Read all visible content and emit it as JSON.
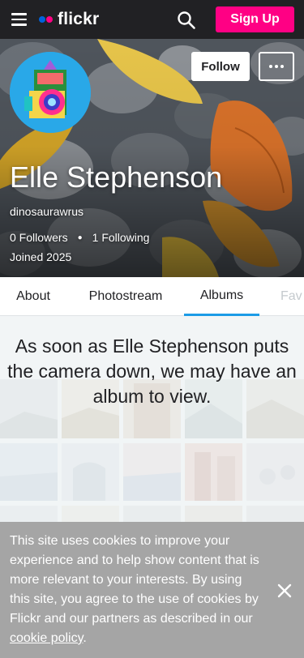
{
  "header": {
    "logo_text": "flickr",
    "signup_label": "Sign Up",
    "icons": [
      "menu-icon",
      "search-icon"
    ],
    "colors": {
      "bar": "#212124",
      "brand_blue": "#0063dc",
      "brand_pink": "#ff0084"
    }
  },
  "profile": {
    "follow_label": "Follow",
    "name": "Elle Stephenson",
    "username": "dinosaurawrus",
    "followers": "0 Followers",
    "following": "1 Following",
    "joined": "Joined 2025"
  },
  "tabs": [
    {
      "label": "About"
    },
    {
      "label": "Photostream"
    },
    {
      "label": "Albums",
      "active": true
    },
    {
      "label": "Fav"
    }
  ],
  "albums": {
    "empty_message": "As soon as Elle Stephenson puts the camera down, we may have an album to view."
  },
  "cookie": {
    "text": "This site uses cookies to improve your experience and to help show content that is more relevant to your interests. By using this site, you agree to the use of cookies by Flickr and our partners as described in our ",
    "link": "cookie policy",
    "suffix": "."
  }
}
